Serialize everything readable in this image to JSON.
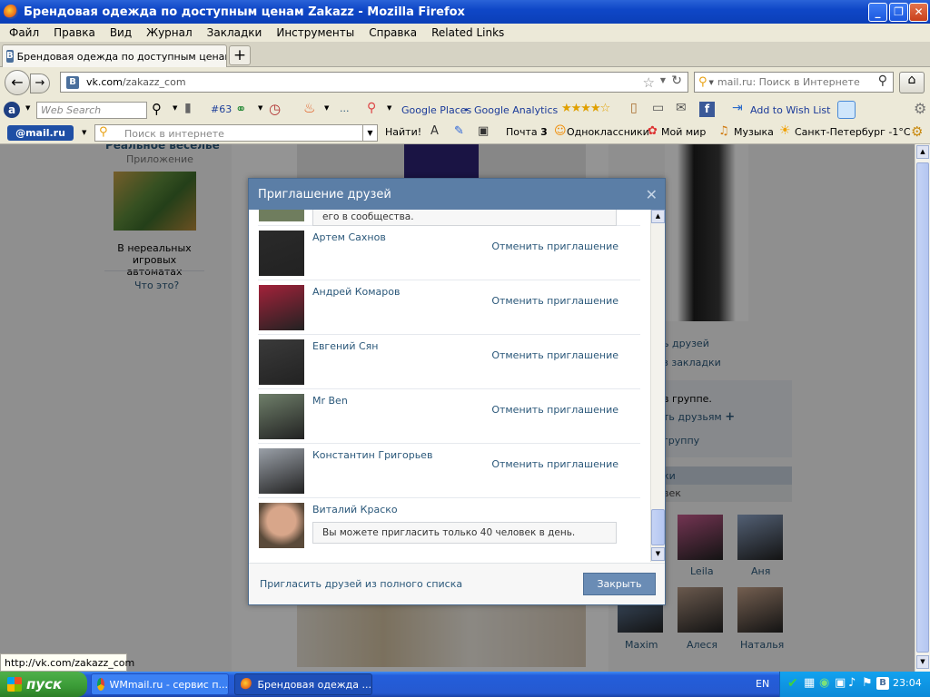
{
  "window": {
    "title": "Брендовая одежда по доступным ценам Zakazz - Mozilla Firefox"
  },
  "menu": [
    "Файл",
    "Правка",
    "Вид",
    "Журнал",
    "Закладки",
    "Инструменты",
    "Справка",
    "Related Links"
  ],
  "tab": {
    "label": "Брендовая одежда по доступным ценам Z...",
    "new_tab": "+"
  },
  "nav": {
    "url_domain": "vk.com",
    "url_path": "/zakazz_com",
    "search_placeholder": "mail.ru: Поиск в Интернете"
  },
  "toolbar1": {
    "web_search_placeholder": "Web Search",
    "counter": "#63",
    "ellipsis": "...",
    "google_places": "Google Places",
    "google_analytics": "Google Analytics",
    "add_to_wish_list": "Add to Wish List"
  },
  "toolbar2": {
    "logo": "@mail.ru",
    "search_placeholder": "Поиск в интернете",
    "find": "Найти!",
    "mail_label": "Почта",
    "mail_count": "3",
    "odnoklassniki": "Одноклассники",
    "moy_mir": "Мой мир",
    "music": "Музыка",
    "weather": "Санкт-Петербург -1°C"
  },
  "page": {
    "app_title_partial": "Реальное веселье",
    "app_label": "Приложение",
    "ad_text": "В нереальных игровых автоматах",
    "what_is_it": "Что это?",
    "right_links": [
      "ь друзей",
      "з закладки"
    ],
    "group_text": "в группе.",
    "invite_friends": "ть друзьям",
    "group_link": "группу",
    "bar_header": "ки",
    "bar_sub": "век",
    "friends": [
      {
        "name": "Leila",
        "color": "#c75b8e"
      },
      {
        "name": "Аня",
        "color": "#8fa6c9"
      },
      {
        "name": "Maxim",
        "color": "#6d8db5"
      },
      {
        "name": "Алеся",
        "color": "#b79a86"
      },
      {
        "name": "Наталья",
        "color": "#c7a38a"
      }
    ]
  },
  "dialog": {
    "title": "Приглашение друзей",
    "close": "✕",
    "top_notice": "его в сообщества.",
    "cancel_label": "Отменить приглашение",
    "friends": [
      {
        "name": "Артем Сахнов",
        "color": "#2a2a2a"
      },
      {
        "name": "Андрей Комаров",
        "color": "#a3223a"
      },
      {
        "name": "Евгений Сян",
        "color": "#3a3a3a"
      },
      {
        "name": "Mr Ben",
        "color": "#6f7f6a"
      },
      {
        "name": "Константин Григорьев",
        "color": "#9aa0a8"
      }
    ],
    "last_friend": "Виталий Краско",
    "last_notice": "Вы можете пригласить только 40 человек в день.",
    "footer_link": "Пригласить друзей из полного списка",
    "close_button": "Закрыть"
  },
  "status": {
    "url": "http://vk.com/zakazz_com"
  },
  "taskbar": {
    "start": "пуск",
    "task1": "WMmail.ru - сервис п...",
    "task2": "Брендовая одежда ...",
    "lang": "EN",
    "clock": "23:04"
  }
}
